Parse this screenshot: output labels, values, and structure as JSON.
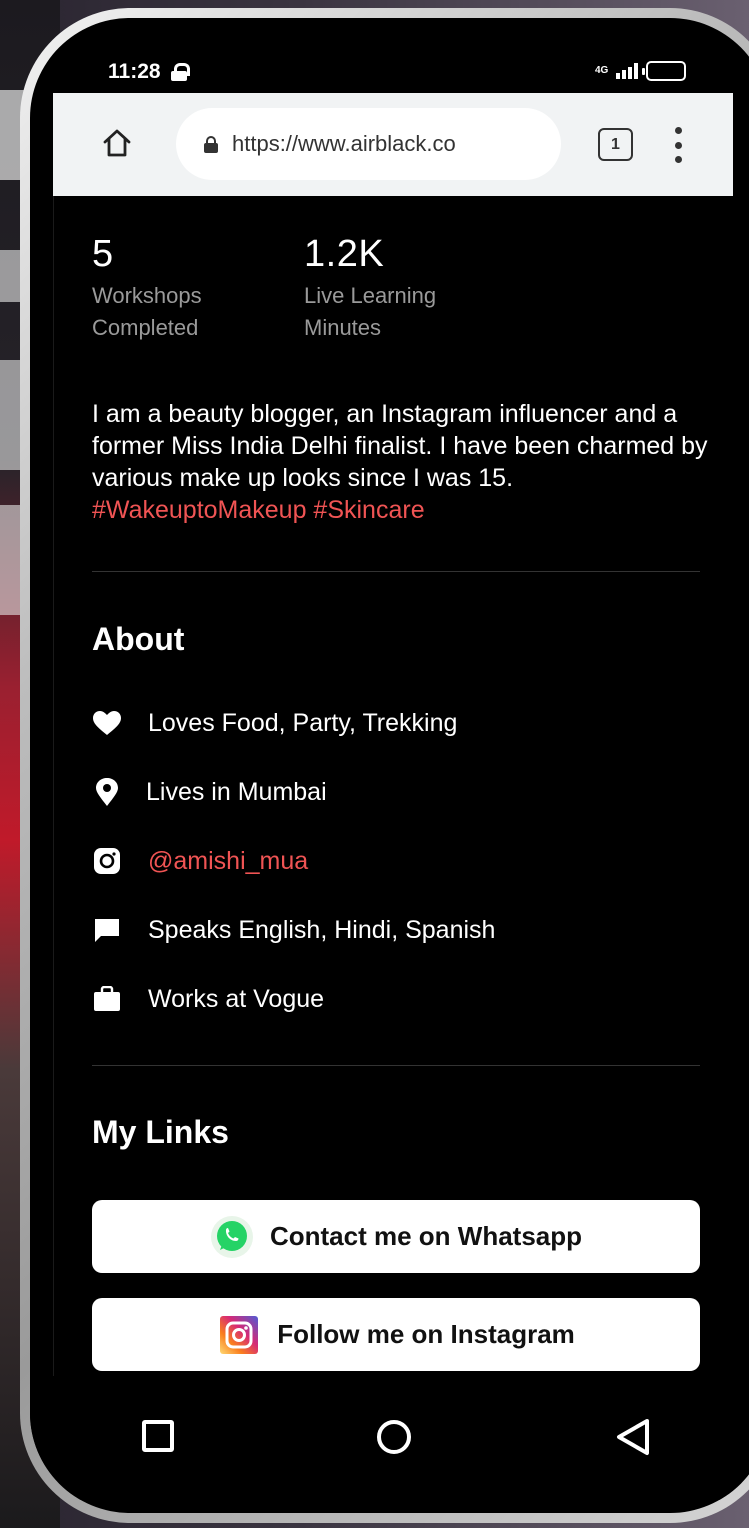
{
  "status_bar": {
    "time": "11:28",
    "network": "4G"
  },
  "browser": {
    "url": "https://www.airblack.co",
    "tab_count": "1"
  },
  "stats": [
    {
      "value": "5",
      "label": "Workshops Completed"
    },
    {
      "value": "1.2K",
      "label": "Live Learning Minutes"
    }
  ],
  "bio": {
    "text": "I am a beauty blogger, an Instagram influencer and a former Miss India Delhi finalist. I have been charmed by various make up looks since I was 15. ",
    "hashtags": "#WakeuptoMakeup #Skincare"
  },
  "about": {
    "title": "About",
    "items": [
      {
        "icon": "heart-icon",
        "text": "Loves Food, Party, Trekking"
      },
      {
        "icon": "location-pin-icon",
        "text": "Lives in Mumbai"
      },
      {
        "icon": "instagram-icon",
        "text": "@amishi_mua"
      },
      {
        "icon": "chat-icon",
        "text": "Speaks English, Hindi, Spanish"
      },
      {
        "icon": "briefcase-icon",
        "text": "Works at Vogue"
      }
    ]
  },
  "links": {
    "title": "My Links",
    "buttons": [
      {
        "icon": "whatsapp-icon",
        "label": "Contact me on Whatsapp"
      },
      {
        "icon": "instagram-icon",
        "label": "Follow me on Instagram"
      }
    ]
  },
  "colors": {
    "accent": "#f05454",
    "background": "#000000",
    "muted_text": "#9a9a9a"
  }
}
